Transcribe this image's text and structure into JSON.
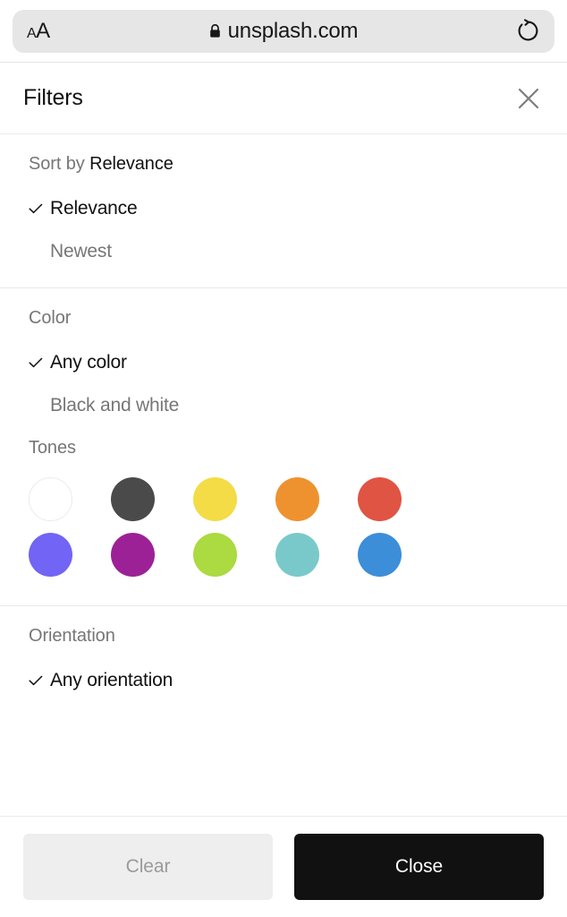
{
  "browser": {
    "text_size_icon": "text-size-icon",
    "text_size_small": "A",
    "text_size_large": "A",
    "lock_icon": "lock-icon",
    "url": "unsplash.com",
    "reload_icon": "reload-icon"
  },
  "panel": {
    "title": "Filters",
    "close_icon": "close-icon"
  },
  "sort": {
    "label_prefix": "Sort by",
    "selected_value": "Relevance",
    "options": [
      {
        "label": "Relevance",
        "selected": true
      },
      {
        "label": "Newest",
        "selected": false
      }
    ]
  },
  "color": {
    "label": "Color",
    "options": [
      {
        "label": "Any color",
        "selected": true
      },
      {
        "label": "Black and white",
        "selected": false
      }
    ],
    "tones_label": "Tones",
    "tones": [
      {
        "name": "white",
        "hex": "#ffffff",
        "outlined": true
      },
      {
        "name": "black",
        "hex": "#4a4a4a",
        "outlined": false
      },
      {
        "name": "yellow",
        "hex": "#f3dc45",
        "outlined": false
      },
      {
        "name": "orange",
        "hex": "#ee922f",
        "outlined": false
      },
      {
        "name": "red",
        "hex": "#e05443",
        "outlined": false
      },
      {
        "name": "purple",
        "hex": "#7264f5",
        "outlined": false
      },
      {
        "name": "magenta",
        "hex": "#9c2196",
        "outlined": false
      },
      {
        "name": "green",
        "hex": "#abda41",
        "outlined": false
      },
      {
        "name": "teal",
        "hex": "#7ac9ca",
        "outlined": false
      },
      {
        "name": "blue",
        "hex": "#3c8ed9",
        "outlined": false
      }
    ]
  },
  "orientation": {
    "label": "Orientation",
    "options": [
      {
        "label": "Any orientation",
        "selected": true
      }
    ]
  },
  "footer": {
    "clear_label": "Clear",
    "close_label": "Close"
  }
}
